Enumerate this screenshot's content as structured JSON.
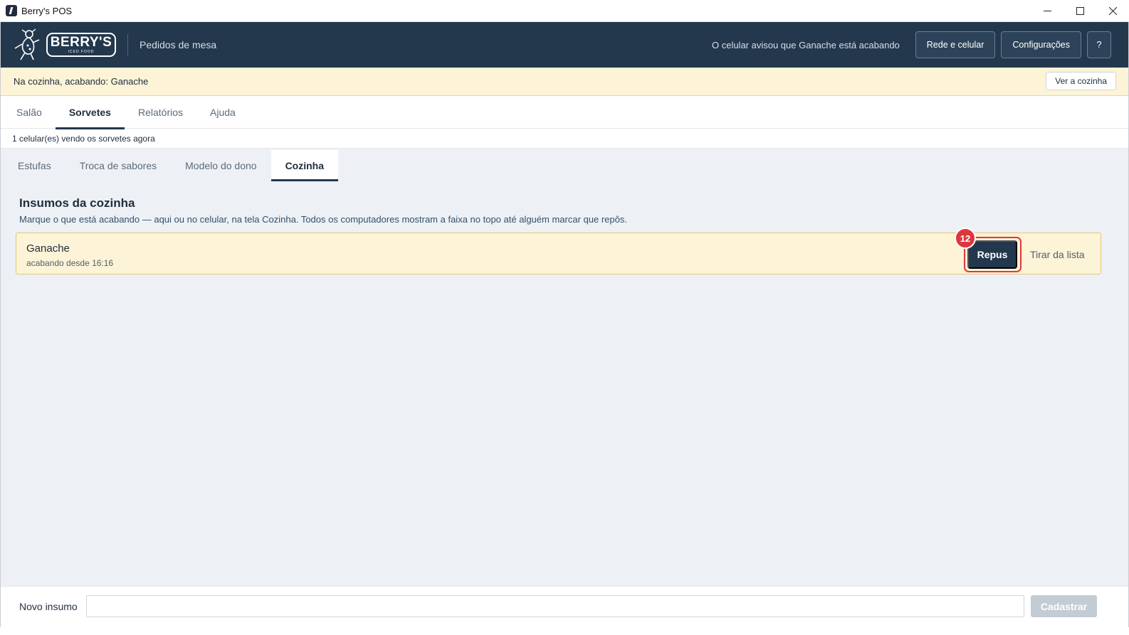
{
  "window": {
    "title": "Berry's POS"
  },
  "header": {
    "logo_text": "BERRY'S",
    "logo_sub": "ICED FOOD",
    "section_title": "Pedidos de mesa",
    "notice": "O celular avisou que Ganache está acabando",
    "buttons": {
      "network": "Rede e celular",
      "settings": "Configurações",
      "help": "?"
    },
    "colors": {
      "background": "#23384d"
    }
  },
  "banner": {
    "text": "Na cozinha, acabando: Ganache",
    "button": "Ver a cozinha",
    "colors": {
      "background": "#fdf3d6"
    }
  },
  "main_tabs": [
    {
      "label": "Salão",
      "active": false
    },
    {
      "label": "Sorvetes",
      "active": true
    },
    {
      "label": "Relatórios",
      "active": false
    },
    {
      "label": "Ajuda",
      "active": false
    }
  ],
  "status_line": "1 celular(es) vendo os sorvetes agora",
  "sub_tabs": [
    {
      "label": "Estufas",
      "active": false
    },
    {
      "label": "Troca de sabores",
      "active": false
    },
    {
      "label": "Modelo do dono",
      "active": false
    },
    {
      "label": "Cozinha",
      "active": true
    }
  ],
  "panel": {
    "title": "Insumos da cozinha",
    "description": "Marque o que está acabando — aqui ou no celular, na tela Cozinha. Todos os computadores mostram a faixa no topo até alguém marcar que repôs."
  },
  "items": [
    {
      "name": "Ganache",
      "status": "acabando desde 16:16",
      "primary_action": "Repus",
      "secondary_action": "Tirar da lista",
      "badge": "12"
    }
  ],
  "footer": {
    "label": "Novo insumo",
    "input_value": "",
    "input_placeholder": "",
    "submit": "Cadastrar"
  }
}
